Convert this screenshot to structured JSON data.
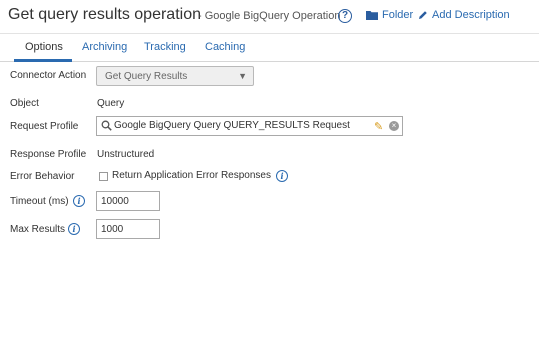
{
  "header": {
    "title": "Get query results operation",
    "subtitle": "- Google BigQuery Operation",
    "help_glyph": "?",
    "folder_label": "Folder",
    "add_description_label": "Add Description"
  },
  "tabs": [
    {
      "label": "Options",
      "active": true
    },
    {
      "label": "Archiving",
      "active": false
    },
    {
      "label": "Tracking",
      "active": false
    },
    {
      "label": "Caching",
      "active": false
    }
  ],
  "form": {
    "connector_action": {
      "label": "Connector Action",
      "value": "Get Query Results"
    },
    "object": {
      "label": "Object",
      "value": "Query"
    },
    "request_profile": {
      "label": "Request Profile",
      "value": "Google BigQuery Query QUERY_RESULTS Request"
    },
    "response_profile": {
      "label": "Response Profile",
      "value": "Unstructured"
    },
    "error_behavior": {
      "label": "Error Behavior",
      "checkbox_label": "Return Application Error Responses",
      "checked": false
    },
    "timeout": {
      "label": "Timeout (ms)",
      "value": "10000"
    },
    "max_results": {
      "label": "Max Results",
      "value": "1000"
    }
  },
  "icons": {
    "info_glyph": "i",
    "folder": "folder-icon",
    "pencil": "pencil-icon",
    "search": "search-icon",
    "clear": "clear-icon"
  },
  "colors": {
    "link": "#2a6ab0",
    "accent_underline": "#2a6ab0",
    "edit_icon": "#d79a1a"
  }
}
